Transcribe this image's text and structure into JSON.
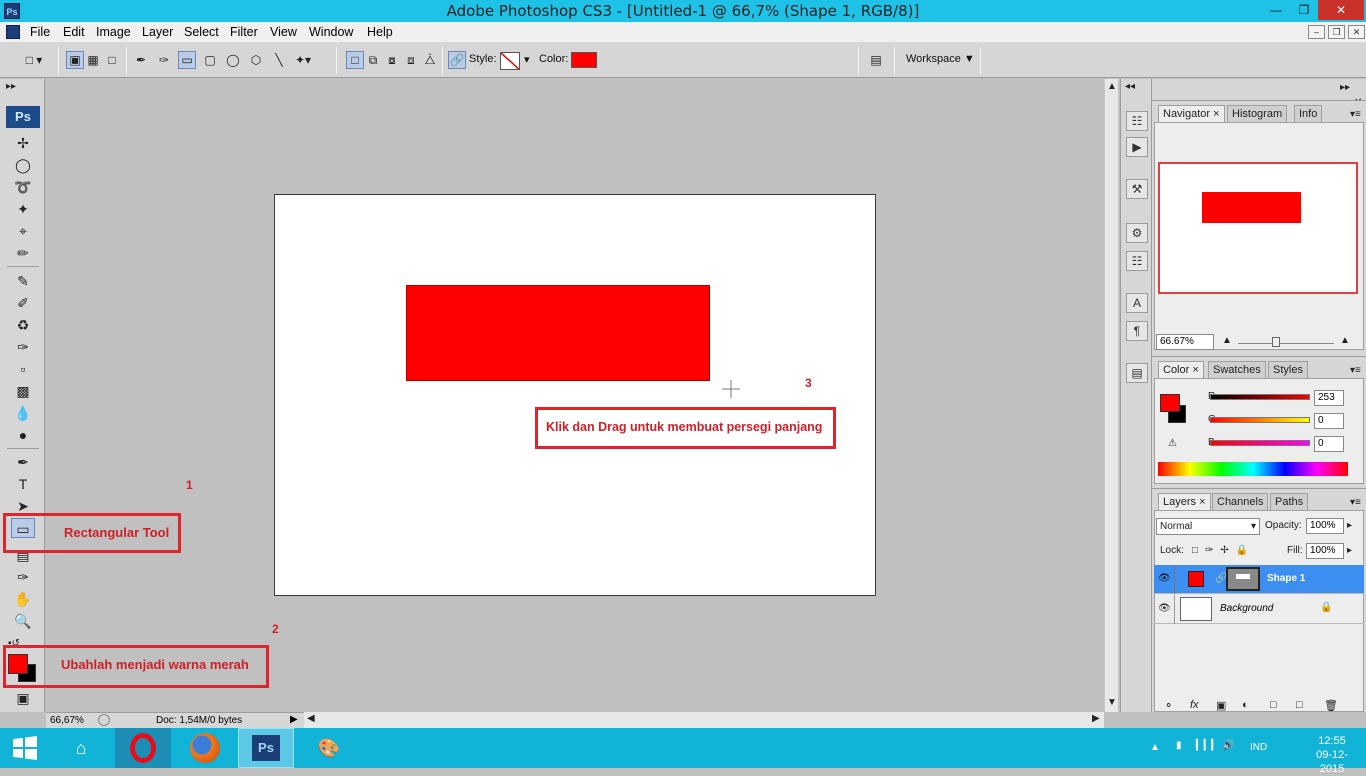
{
  "window": {
    "title": "Adobe Photoshop CS3 - [Untitled-1 @ 66,7% (Shape 1, RGB/8)]",
    "app_icon": "Ps",
    "minimize": "—",
    "maximize": "❐",
    "close": "✕"
  },
  "menu": {
    "items": [
      "File",
      "Edit",
      "Image",
      "Layer",
      "Select",
      "Filter",
      "View",
      "Window",
      "Help"
    ],
    "mdi_min": "–",
    "mdi_restore": "❐",
    "mdi_close": "✕"
  },
  "options": {
    "style_label": "Style:",
    "color_label": "Color:",
    "workspace_label": "Workspace ▼",
    "shape_color": "#ff0000"
  },
  "toolbox": {
    "logo": "Ps",
    "foreground": "#ff0000",
    "background": "#000000"
  },
  "document": {
    "shape_fill": "#ff0000"
  },
  "status": {
    "zoom": "66,67%",
    "doc": "Doc: 1,54M/0 bytes"
  },
  "navigator": {
    "tabs": [
      "Navigator",
      "Histogram",
      "Info"
    ],
    "zoom": "66.67%"
  },
  "color_panel": {
    "tabs": [
      "Color",
      "Swatches",
      "Styles"
    ],
    "r_label": "R",
    "g_label": "G",
    "b_label": "B",
    "r": "253",
    "g": "0",
    "b": "0"
  },
  "layers_panel": {
    "tabs": [
      "Layers",
      "Channels",
      "Paths"
    ],
    "blend_mode": "Normal",
    "opacity_label": "Opacity:",
    "opacity": "100%",
    "lock_label": "Lock:",
    "fill_label": "Fill:",
    "fill": "100%",
    "layers": [
      {
        "name": "Shape 1",
        "selected": true
      },
      {
        "name": "Background",
        "selected": false
      }
    ],
    "footer_icons": [
      "link-icon",
      "fx-icon",
      "mask-icon",
      "adjustment-icon",
      "group-icon",
      "new-layer-icon",
      "trash-icon"
    ]
  },
  "annotations": {
    "step1_num": "1",
    "step1_text": "Rectangular Tool",
    "step2_num": "2",
    "step2_text": "Ubahlah menjadi warna merah",
    "step3_num": "3",
    "step3_text": "Klik dan Drag untuk membuat persegi panjang"
  },
  "taskbar": {
    "language": "IND",
    "time": "12:55",
    "date": "09-12-2015"
  }
}
